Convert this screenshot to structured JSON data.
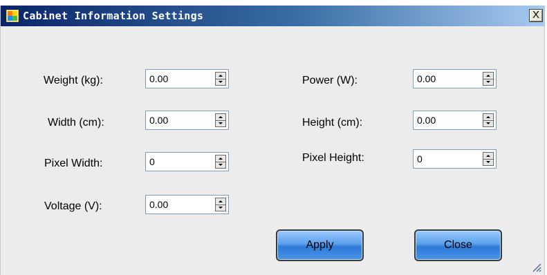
{
  "window": {
    "title": "Cabinet Information Settings",
    "close_label": "X"
  },
  "fields": {
    "weight": {
      "label": "Weight (kg):",
      "value": "0.00"
    },
    "width": {
      "label": "Width (cm):",
      "value": "0.00"
    },
    "pixel_width": {
      "label": "Pixel Width:",
      "value": "0"
    },
    "voltage": {
      "label": "Voltage (V):",
      "value": "0.00"
    },
    "power": {
      "label": "Power (W):",
      "value": "0.00"
    },
    "height": {
      "label": "Height (cm):",
      "value": "0.00"
    },
    "pixel_height": {
      "label": "Pixel Height:",
      "value": "0"
    }
  },
  "buttons": {
    "apply": "Apply",
    "close": "Close"
  }
}
